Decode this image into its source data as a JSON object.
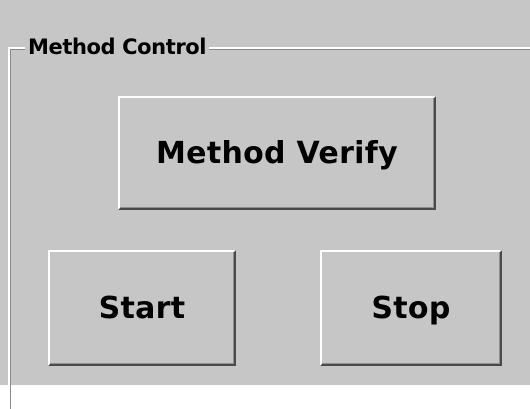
{
  "group": {
    "title": "Method Control"
  },
  "buttons": {
    "method_verify": "Method Verify",
    "start": "Start",
    "stop": "Stop"
  }
}
